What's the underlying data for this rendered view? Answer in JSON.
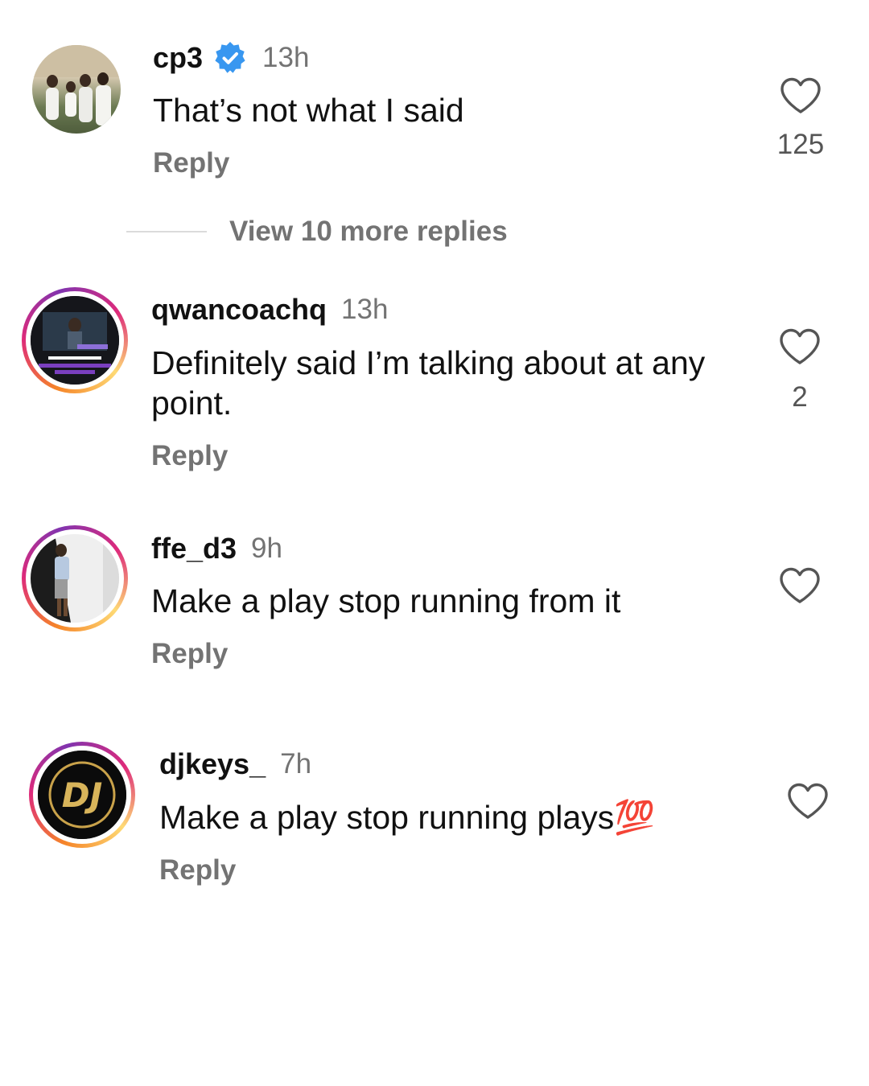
{
  "comments": [
    {
      "username": "cp3",
      "verified": true,
      "time": "13h",
      "text": "That’s not what I said",
      "reply_label": "Reply",
      "likes": "125",
      "avatar_icon": "group-photo-avatar"
    },
    {
      "username": "qwancoachq",
      "time": "13h",
      "text": "Definitely said I’m talking about at any point.",
      "reply_label": "Reply",
      "likes": "2",
      "avatar_icon": "story-ring-avatar"
    },
    {
      "username": "ffe_d3",
      "time": "9h",
      "text": "Make a play stop running from it",
      "reply_label": "Reply",
      "likes": "",
      "avatar_icon": "story-ring-avatar"
    },
    {
      "username": "djkeys_",
      "time": "7h",
      "text": "Make a play stop running plays💯",
      "reply_label": "Reply",
      "likes": "",
      "avatar_icon": "dj-logo-avatar"
    }
  ],
  "view_more": "View 10 more replies",
  "colors": {
    "verified_blue": "#3897f0",
    "secondary_text": "#737373",
    "story_ring": [
      "#f58529",
      "#dd2a7b",
      "#8134af",
      "#feda75"
    ]
  }
}
